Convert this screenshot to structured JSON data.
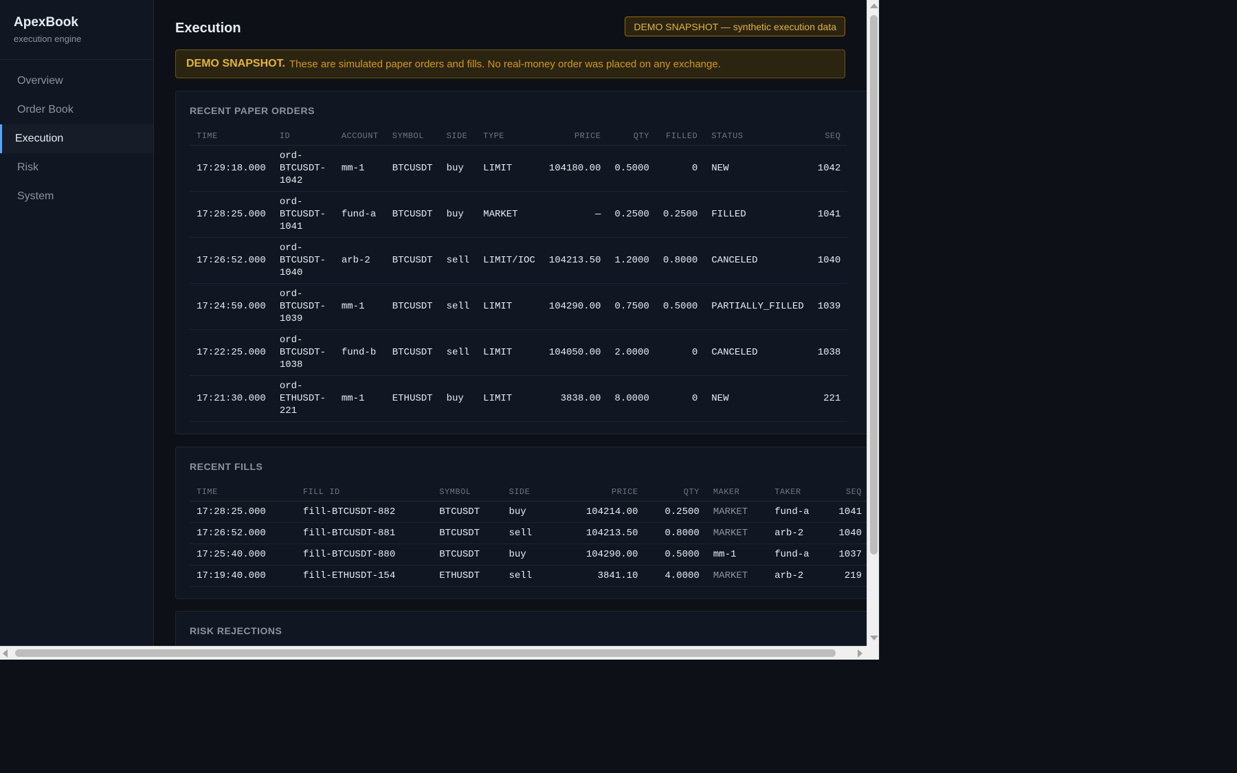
{
  "sidebar": {
    "brand_title": "ApexBook",
    "brand_subtitle": "execution engine",
    "items": [
      {
        "label": "Overview",
        "active": false
      },
      {
        "label": "Order Book",
        "active": false
      },
      {
        "label": "Execution",
        "active": true
      },
      {
        "label": "Risk",
        "active": false
      },
      {
        "label": "System",
        "active": false
      }
    ]
  },
  "header": {
    "title": "Execution",
    "badge": "DEMO SNAPSHOT — synthetic execution data"
  },
  "banner": {
    "strong": "DEMO SNAPSHOT.",
    "text": "These are simulated paper orders and fills. No real-money order was placed on any exchange."
  },
  "orders": {
    "title": "RECENT PAPER ORDERS",
    "columns": [
      "TIME",
      "ID",
      "ACCOUNT",
      "SYMBOL",
      "SIDE",
      "TYPE",
      "PRICE",
      "QTY",
      "FILLED",
      "STATUS",
      "SEQ"
    ],
    "rows": [
      {
        "time": "17:29:18.000",
        "id": [
          "ord-",
          "BTCUSDT-",
          "1042"
        ],
        "account": "mm-1",
        "symbol": "BTCUSDT",
        "side": "buy",
        "type": "LIMIT",
        "price": "104180.00",
        "qty": "0.5000",
        "filled": "0",
        "status": "NEW",
        "seq": "1042"
      },
      {
        "time": "17:28:25.000",
        "id": [
          "ord-",
          "BTCUSDT-",
          "1041"
        ],
        "account": "fund-a",
        "symbol": "BTCUSDT",
        "side": "buy",
        "type": "MARKET",
        "price": "—",
        "qty": "0.2500",
        "filled": "0.2500",
        "status": "FILLED",
        "seq": "1041"
      },
      {
        "time": "17:26:52.000",
        "id": [
          "ord-",
          "BTCUSDT-",
          "1040"
        ],
        "account": "arb-2",
        "symbol": "BTCUSDT",
        "side": "sell",
        "type": "LIMIT/IOC",
        "price": "104213.50",
        "qty": "1.2000",
        "filled": "0.8000",
        "status": "CANCELED",
        "seq": "1040"
      },
      {
        "time": "17:24:59.000",
        "id": [
          "ord-",
          "BTCUSDT-",
          "1039"
        ],
        "account": "mm-1",
        "symbol": "BTCUSDT",
        "side": "sell",
        "type": "LIMIT",
        "price": "104290.00",
        "qty": "0.7500",
        "filled": "0.5000",
        "status": "PARTIALLY_FILLED",
        "seq": "1039"
      },
      {
        "time": "17:22:25.000",
        "id": [
          "ord-",
          "BTCUSDT-",
          "1038"
        ],
        "account": "fund-b",
        "symbol": "BTCUSDT",
        "side": "sell",
        "type": "LIMIT",
        "price": "104050.00",
        "qty": "2.0000",
        "filled": "0",
        "status": "CANCELED",
        "seq": "1038"
      },
      {
        "time": "17:21:30.000",
        "id": [
          "ord-",
          "ETHUSDT-",
          "221"
        ],
        "account": "mm-1",
        "symbol": "ETHUSDT",
        "side": "buy",
        "type": "LIMIT",
        "price": "3838.00",
        "qty": "8.0000",
        "filled": "0",
        "status": "NEW",
        "seq": "221"
      }
    ]
  },
  "fills": {
    "title": "RECENT FILLS",
    "columns": [
      "TIME",
      "FILL ID",
      "SYMBOL",
      "SIDE",
      "PRICE",
      "QTY",
      "MAKER",
      "TAKER",
      "SEQ"
    ],
    "rows": [
      {
        "time": "17:28:25.000",
        "fill_id": "fill-BTCUSDT-882",
        "symbol": "BTCUSDT",
        "side": "buy",
        "price": "104214.00",
        "qty": "0.2500",
        "maker": "MARKET",
        "taker": "fund-a",
        "seq": "1041"
      },
      {
        "time": "17:26:52.000",
        "fill_id": "fill-BTCUSDT-881",
        "symbol": "BTCUSDT",
        "side": "sell",
        "price": "104213.50",
        "qty": "0.8000",
        "maker": "MARKET",
        "taker": "arb-2",
        "seq": "1040"
      },
      {
        "time": "17:25:40.000",
        "fill_id": "fill-BTCUSDT-880",
        "symbol": "BTCUSDT",
        "side": "buy",
        "price": "104290.00",
        "qty": "0.5000",
        "maker": "mm-1",
        "taker": "fund-a",
        "seq": "1037"
      },
      {
        "time": "17:19:40.000",
        "fill_id": "fill-ETHUSDT-154",
        "symbol": "ETHUSDT",
        "side": "sell",
        "price": "3841.10",
        "qty": "4.0000",
        "maker": "MARKET",
        "taker": "arb-2",
        "seq": "219"
      }
    ]
  },
  "risk": {
    "title": "RISK REJECTIONS"
  },
  "colors": {
    "background": "#0d1117",
    "panel": "#111722",
    "accent": "#58a6ff",
    "warning": "#e3b341"
  }
}
